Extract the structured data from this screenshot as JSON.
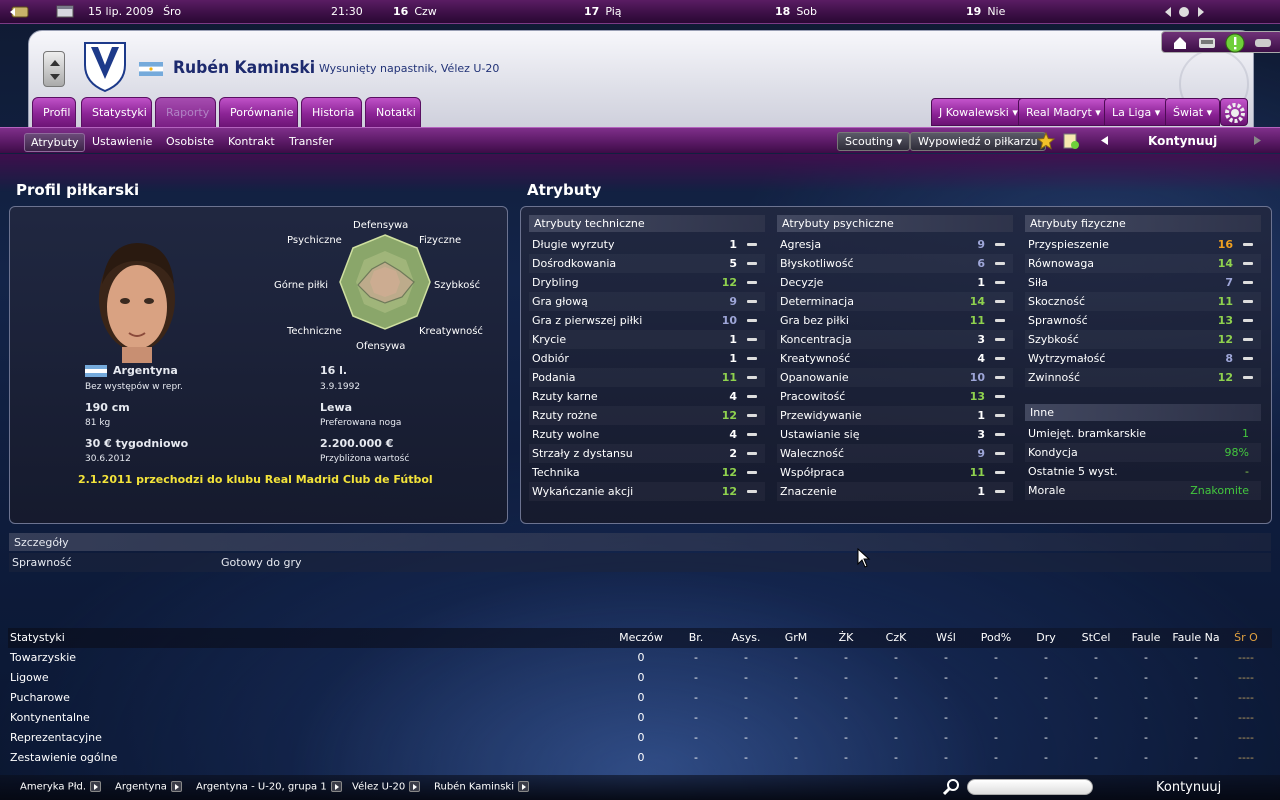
{
  "topbar": {
    "date_full": "15 lip. 2009",
    "day_full": "Śro",
    "time": "21:30",
    "days": [
      {
        "num": "16",
        "name": "Czw"
      },
      {
        "num": "17",
        "name": "Pią"
      },
      {
        "num": "18",
        "name": "Sob"
      },
      {
        "num": "19",
        "name": "Nie"
      }
    ]
  },
  "player": {
    "name": "Rubén Kaminski",
    "role": "Wysunięty napastnik, Vélez U-20"
  },
  "tabs": [
    "Profil",
    "Statystyki",
    "Raporty",
    "Porównanie",
    "Historia",
    "Notatki"
  ],
  "right_tabs": [
    "J Kowalewski",
    "Real Madryt",
    "La Liga",
    "Świat"
  ],
  "subtabs": [
    "Atrybuty",
    "Ustawienie",
    "Osobiste",
    "Kontrakt",
    "Transfer"
  ],
  "actions": {
    "scouting": "Scouting",
    "statement": "Wypowiedź o piłkarzu",
    "continue": "Kontynuuj"
  },
  "profile": {
    "title": "Profil piłkarski",
    "radar_labels": [
      "Defensywa",
      "Fizyczne",
      "Szybkość",
      "Kreatywność",
      "Ofensywa",
      "Techniczne",
      "Górne piłki",
      "Psychiczne"
    ],
    "nationality": "Argentyna",
    "caps": "Bez występów w repr.",
    "age": "16 l.",
    "dob": "3.9.1992",
    "height": "190 cm",
    "weight": "81 kg",
    "foot": "Lewa",
    "foot_label": "Preferowana noga",
    "wage": "30 € tygodniowo",
    "contract_end": "30.6.2012",
    "value": "2.200.000 €",
    "value_label": "Przybliżona wartość",
    "transfer_note": "2.1.2011 przechodzi do klubu Real Madrid Club de Fútbol"
  },
  "attributes": {
    "title": "Atrybuty",
    "technical": {
      "title": "Atrybuty techniczne",
      "items": [
        {
          "name": "Długie wyrzuty",
          "value": "1",
          "color": "#ffffff"
        },
        {
          "name": "Dośrodkowania",
          "value": "5",
          "color": "#ffffff"
        },
        {
          "name": "Drybling",
          "value": "12",
          "color": "#8fd24e"
        },
        {
          "name": "Gra głową",
          "value": "9",
          "color": "#9ea6d8"
        },
        {
          "name": "Gra z pierwszej piłki",
          "value": "10",
          "color": "#9ea6d8"
        },
        {
          "name": "Krycie",
          "value": "1",
          "color": "#ffffff"
        },
        {
          "name": "Odbiór",
          "value": "1",
          "color": "#ffffff"
        },
        {
          "name": "Podania",
          "value": "11",
          "color": "#8fd24e"
        },
        {
          "name": "Rzuty karne",
          "value": "4",
          "color": "#ffffff"
        },
        {
          "name": "Rzuty rożne",
          "value": "12",
          "color": "#8fd24e"
        },
        {
          "name": "Rzuty wolne",
          "value": "4",
          "color": "#ffffff"
        },
        {
          "name": "Strzały z dystansu",
          "value": "2",
          "color": "#ffffff"
        },
        {
          "name": "Technika",
          "value": "12",
          "color": "#8fd24e"
        },
        {
          "name": "Wykańczanie akcji",
          "value": "12",
          "color": "#8fd24e"
        }
      ]
    },
    "mental": {
      "title": "Atrybuty psychiczne",
      "items": [
        {
          "name": "Agresja",
          "value": "9",
          "color": "#9ea6d8"
        },
        {
          "name": "Błyskotliwość",
          "value": "6",
          "color": "#9ea6d8"
        },
        {
          "name": "Decyzje",
          "value": "1",
          "color": "#ffffff"
        },
        {
          "name": "Determinacja",
          "value": "14",
          "color": "#8fd24e"
        },
        {
          "name": "Gra bez piłki",
          "value": "11",
          "color": "#8fd24e"
        },
        {
          "name": "Koncentracja",
          "value": "3",
          "color": "#ffffff"
        },
        {
          "name": "Kreatywność",
          "value": "4",
          "color": "#ffffff"
        },
        {
          "name": "Opanowanie",
          "value": "10",
          "color": "#9ea6d8"
        },
        {
          "name": "Pracowitość",
          "value": "13",
          "color": "#8fd24e"
        },
        {
          "name": "Przewidywanie",
          "value": "1",
          "color": "#ffffff"
        },
        {
          "name": "Ustawianie się",
          "value": "3",
          "color": "#ffffff"
        },
        {
          "name": "Waleczność",
          "value": "9",
          "color": "#9ea6d8"
        },
        {
          "name": "Współpraca",
          "value": "11",
          "color": "#8fd24e"
        },
        {
          "name": "Znaczenie",
          "value": "1",
          "color": "#ffffff"
        }
      ]
    },
    "physical": {
      "title": "Atrybuty fizyczne",
      "items": [
        {
          "name": "Przyspieszenie",
          "value": "16",
          "color": "#f0a020"
        },
        {
          "name": "Równowaga",
          "value": "14",
          "color": "#8fd24e"
        },
        {
          "name": "Siła",
          "value": "7",
          "color": "#9ea6d8"
        },
        {
          "name": "Skoczność",
          "value": "11",
          "color": "#8fd24e"
        },
        {
          "name": "Sprawność",
          "value": "13",
          "color": "#8fd24e"
        },
        {
          "name": "Szybkość",
          "value": "12",
          "color": "#8fd24e"
        },
        {
          "name": "Wytrzymałość",
          "value": "8",
          "color": "#9ea6d8"
        },
        {
          "name": "Zwinność",
          "value": "12",
          "color": "#8fd24e"
        }
      ]
    },
    "other": {
      "title": "Inne",
      "items": [
        {
          "name": "Umiejęt. bramkarskie",
          "value": "1"
        },
        {
          "name": "Kondycja",
          "value": "98%"
        },
        {
          "name": "Ostatnie 5 wyst.",
          "value": "-"
        },
        {
          "name": "Morale",
          "value": "Znakomite"
        }
      ]
    }
  },
  "details": {
    "title": "Szczegóły",
    "label": "Sprawność",
    "value": "Gotowy do gry"
  },
  "stats": {
    "headers": [
      "Statystyki",
      "Meczów",
      "Br.",
      "Asys.",
      "GrM",
      "ŻK",
      "CzK",
      "Wśl",
      "Pod%",
      "Dry",
      "StCel",
      "Faule",
      "Faule Na",
      "Śr O"
    ],
    "rows": [
      [
        "Towarzyskie",
        "0",
        "-",
        "-",
        "-",
        "-",
        "-",
        "-",
        "-",
        "-",
        "-",
        "-",
        "-",
        "----"
      ],
      [
        "Ligowe",
        "0",
        "-",
        "-",
        "-",
        "-",
        "-",
        "-",
        "-",
        "-",
        "-",
        "-",
        "-",
        "----"
      ],
      [
        "Pucharowe",
        "0",
        "-",
        "-",
        "-",
        "-",
        "-",
        "-",
        "-",
        "-",
        "-",
        "-",
        "-",
        "----"
      ],
      [
        "Kontynentalne",
        "0",
        "-",
        "-",
        "-",
        "-",
        "-",
        "-",
        "-",
        "-",
        "-",
        "-",
        "-",
        "----"
      ],
      [
        "Reprezentacyjne",
        "0",
        "-",
        "-",
        "-",
        "-",
        "-",
        "-",
        "-",
        "-",
        "-",
        "-",
        "-",
        "----"
      ],
      [
        "Zestawienie ogólne",
        "0",
        "-",
        "-",
        "-",
        "-",
        "-",
        "-",
        "-",
        "-",
        "-",
        "-",
        "-",
        "----"
      ]
    ]
  },
  "breadcrumbs": [
    "Ameryka Płd.",
    "Argentyna",
    "Argentyna - U-20, grupa 1",
    "Vélez U-20",
    "Rubén Kaminski"
  ],
  "bottom_continue": "Kontynuuj"
}
